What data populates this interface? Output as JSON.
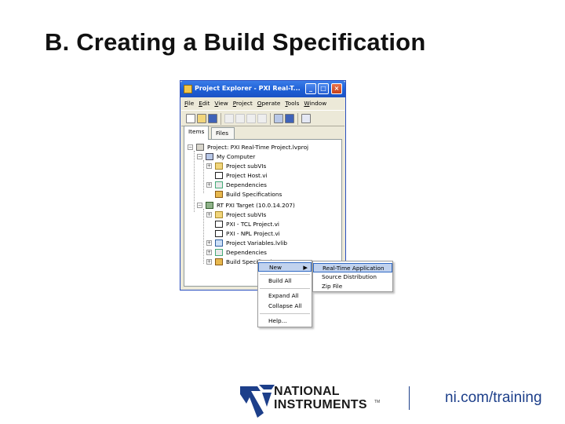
{
  "slide": {
    "title": "B. Creating a Build Specification"
  },
  "window": {
    "title": "Project Explorer - PXI Real-T...",
    "menu": [
      "File",
      "Edit",
      "View",
      "Project",
      "Operate",
      "Tools",
      "Window"
    ],
    "tabs": [
      "Items",
      "Files"
    ],
    "active_tab": "Items",
    "tree": [
      {
        "label": "Project: PXI Real-Time Project.lvproj",
        "icon": "project-icon",
        "level": 0,
        "expander": "-"
      },
      {
        "label": "My Computer",
        "icon": "computer-icon",
        "level": 1,
        "expander": "-"
      },
      {
        "label": "Project subVIs",
        "icon": "folder-icon",
        "level": 2,
        "expander": "+"
      },
      {
        "label": "Project Host.vi",
        "icon": "vi-icon",
        "level": 2,
        "expander": ""
      },
      {
        "label": "Dependencies",
        "icon": "dependencies-icon",
        "level": 2,
        "expander": "+"
      },
      {
        "label": "Build Specifications",
        "icon": "build-spec-icon",
        "level": 2,
        "expander": ""
      },
      {
        "label": "RT PXI Target (10.0.14.207)",
        "icon": "target-icon",
        "level": 1,
        "expander": "-"
      },
      {
        "label": "Project subVIs",
        "icon": "folder-icon",
        "level": 2,
        "expander": "+"
      },
      {
        "label": "PXI - TCL Project.vi",
        "icon": "vi-icon",
        "level": 2,
        "expander": ""
      },
      {
        "label": "PXI - NPL Project.vi",
        "icon": "vi-icon",
        "level": 2,
        "expander": ""
      },
      {
        "label": "Project Variables.lvlib",
        "icon": "library-icon",
        "level": 2,
        "expander": "+"
      },
      {
        "label": "Dependencies",
        "icon": "dependencies-icon",
        "level": 2,
        "expander": "+"
      },
      {
        "label": "Build Specifications",
        "icon": "build-spec-icon",
        "level": 2,
        "expander": "+"
      }
    ]
  },
  "context_menu": {
    "items": [
      "New",
      "Build All",
      "Expand All",
      "Collapse All",
      "Help..."
    ],
    "highlighted": "New"
  },
  "submenu": {
    "items": [
      "Real-Time Application",
      "Source Distribution",
      "Zip File"
    ],
    "highlighted": "Real-Time Application"
  },
  "footer": {
    "logo_line1": "NATIONAL",
    "logo_line2": "INSTRUMENTS",
    "logo_tm": "TM",
    "url": "ni.com/training"
  },
  "colors": {
    "titlebar": "#1d5fd6",
    "menu_highlight": "#c1d2ee",
    "ni_blue": "#1d3f8a"
  }
}
